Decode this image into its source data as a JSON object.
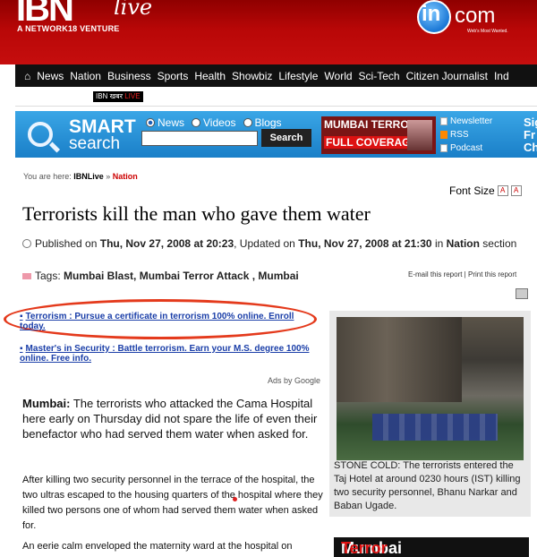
{
  "brand": {
    "logo": "IBN",
    "logo_live": "live",
    "network": "A NETWORK18 VENTURE",
    "incom_in": "in",
    "incom_com": "com",
    "incom_tag": "Web's Most Wanted."
  },
  "nav": {
    "home_icon": "home-icon",
    "items": [
      "News",
      "Nation",
      "Business",
      "Sports",
      "Health",
      "Showbiz",
      "Lifestyle",
      "World",
      "Sci-Tech",
      "Citizen Journalist",
      "Ind"
    ]
  },
  "subnav": {
    "badge_left": "IBN",
    "badge_mid": "खबर",
    "badge_right": "LIVE"
  },
  "search": {
    "logo_line1": "SMART",
    "logo_line2": "search",
    "options": [
      "News",
      "Videos",
      "Blogs"
    ],
    "selected": "News",
    "input_value": "",
    "button": "Search",
    "banner_line1": "MUMBAI TERROR",
    "banner_line2": "FULL COVERAGE",
    "links": [
      "Newsletter",
      "RSS",
      "Podcast"
    ],
    "signup_line1": "Sig",
    "signup_line2": "Fr",
    "signup_line3": "Ch"
  },
  "breadcrumb": {
    "prefix": "You are here: ",
    "home": "IBNLive",
    "sep": " » ",
    "current": "Nation"
  },
  "font_size_label": "Font Size",
  "font_size_buttons": [
    "A",
    "A"
  ],
  "article": {
    "headline": "Terrorists kill the man who gave them water",
    "pub_prefix": "Published on ",
    "published": "Thu, Nov 27, 2008 at 20:23",
    "upd_prefix": ", Updated on ",
    "updated": "Thu, Nov 27, 2008 at 21:30",
    "in_prefix": " in ",
    "section": "Nation",
    "section_suffix": " section",
    "tags_prefix": "Tags: ",
    "tags": "Mumbai Blast, Mumbai Terror Attack , Mumbai",
    "email_print": "E-mail this report | Print this report",
    "lead_place": "Mumbai:",
    "lead_text": " The terrorists who attacked the Cama Hospital here early on Thursday did not spare the life of even their benefactor who had served them water when asked for.",
    "p2": "After killing two security personnel in the terrace of the hospital, the two ultras escaped to the housing quarters of the hospital where they killed two persons one of whom had served them water when asked for.",
    "p3": "An eerie calm enveloped the maternity ward at the hospital on"
  },
  "ads": {
    "ad1": "Terrorism : Pursue a certificate in terrorism 100% online. Enroll today.",
    "ad2": "Master's in Security : Battle terrorism. Earn your M.S. degree 100% online. Free info.",
    "ads_by": "Ads by Google"
  },
  "photo": {
    "caption": "STONE COLD: The terrorists entered the Taj Hotel at around 0230 hours (IST) killing two security personnel, Bhanu Narkar and Baban Ugade."
  },
  "promo": {
    "white": "Mumbai ",
    "red": "Terror Attack"
  },
  "colors": {
    "header_red": "#b80707",
    "nav_black": "#111111",
    "search_blue": "#1a7fc8",
    "link_blue": "#1a3ea8",
    "highlight_red": "#e43a1c"
  }
}
